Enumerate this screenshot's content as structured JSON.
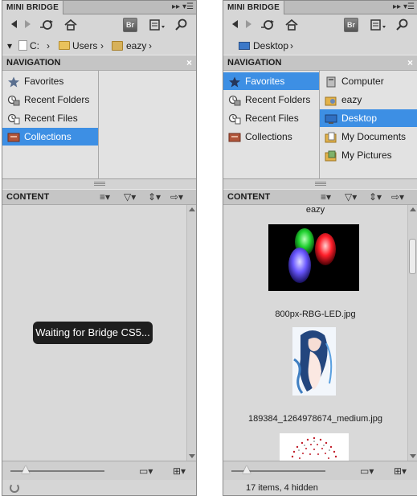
{
  "colors": {
    "panel_bg": "#d6d6d6",
    "selection": "#3d8fe4",
    "header_bg": "#c5c5c5",
    "overlay_bg": "#1e1e1e"
  },
  "left": {
    "tab_title": "MINI BRIDGE",
    "toolbar": {
      "bridge_label": "Br"
    },
    "breadcrumb": [
      "C:",
      "Users",
      "eazy"
    ],
    "navigation": {
      "title": "NAVIGATION",
      "close": "×",
      "items": [
        "Favorites",
        "Recent Folders",
        "Recent Files",
        "Collections"
      ],
      "selected": "Collections"
    },
    "content": {
      "title": "CONTENT",
      "overlay": "Waiting for Bridge CS5..."
    }
  },
  "right": {
    "tab_title": "MINI BRIDGE",
    "toolbar": {
      "bridge_label": "Br"
    },
    "breadcrumb": [
      "Desktop"
    ],
    "navigation": {
      "title": "NAVIGATION",
      "close": "×",
      "items": [
        "Favorites",
        "Recent Folders",
        "Recent Files",
        "Collections"
      ],
      "selected": "Favorites",
      "favorites": [
        "Computer",
        "eazy",
        "Desktop",
        "My Documents",
        "My Pictures"
      ],
      "favorites_selected": "Desktop"
    },
    "content": {
      "title": "CONTENT",
      "items": [
        "eazy",
        "800px-RBG-LED.jpg",
        "189384_1264978674_medium.jpg"
      ]
    },
    "status": "17 items, 4 hidden"
  },
  "icons": [
    "back-icon",
    "forward-icon",
    "sync-icon",
    "home-icon",
    "view-mode-icon",
    "search-icon",
    "sort-icon",
    "filter-icon",
    "tools-icon",
    "output-icon",
    "star-icon",
    "recent-folders-icon",
    "recent-files-icon",
    "collections-icon",
    "computer-icon",
    "folder-icon",
    "monitor-icon",
    "documents-icon",
    "pictures-icon",
    "spinner-icon"
  ]
}
